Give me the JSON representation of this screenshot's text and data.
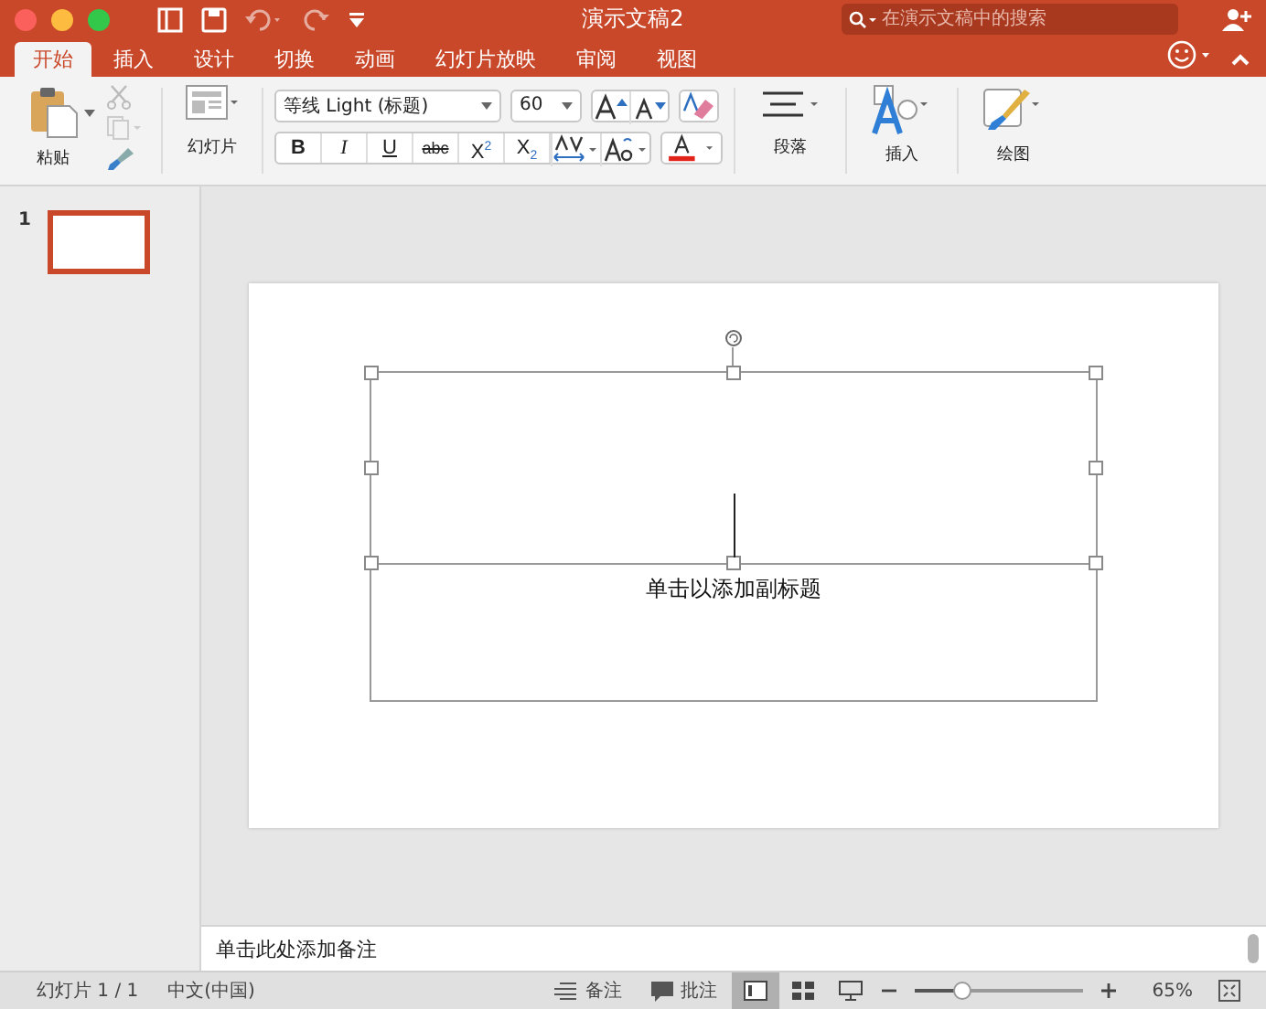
{
  "window": {
    "title": "演示文稿2"
  },
  "search": {
    "placeholder": "在演示文稿中的搜索"
  },
  "tabs": [
    {
      "label": "开始",
      "selected": true
    },
    {
      "label": "插入",
      "selected": false
    },
    {
      "label": "设计",
      "selected": false
    },
    {
      "label": "切换",
      "selected": false
    },
    {
      "label": "动画",
      "selected": false
    },
    {
      "label": "幻灯片放映",
      "selected": false
    },
    {
      "label": "审阅",
      "selected": false
    },
    {
      "label": "视图",
      "selected": false
    }
  ],
  "ribbon": {
    "paste_label": "粘贴",
    "slide_label": "幻灯片",
    "font": "等线 Light (标题)",
    "font_size": "60",
    "format_buttons": [
      {
        "label": "B",
        "kind": "bold"
      },
      {
        "label": "I",
        "kind": "italic"
      },
      {
        "label": "U",
        "kind": "underline"
      },
      {
        "label": "abc",
        "kind": "strike"
      },
      {
        "label": "X$^{2}$",
        "kind": "plain"
      },
      {
        "label": "X$_{2}$",
        "kind": "plain"
      }
    ],
    "groups": [
      "段落",
      "插入",
      "绘图"
    ]
  },
  "thumbnails": [
    {
      "number": "1",
      "selected": true
    }
  ],
  "slide": {
    "subtitle_placeholder": "单击以添加副标题"
  },
  "notes": {
    "placeholder": "单击此处添加备注"
  },
  "status_bar": {
    "slide": "幻灯片 1 / 1",
    "language": "中文(中国)",
    "notes": "备注",
    "comments": "批注",
    "views": [
      {
        "kind": "normal",
        "selected": true
      },
      {
        "kind": "sorter",
        "selected": false
      },
      {
        "kind": "show",
        "selected": false
      }
    ],
    "zoom": {
      "level": 0.29,
      "reading": "65%"
    }
  }
}
